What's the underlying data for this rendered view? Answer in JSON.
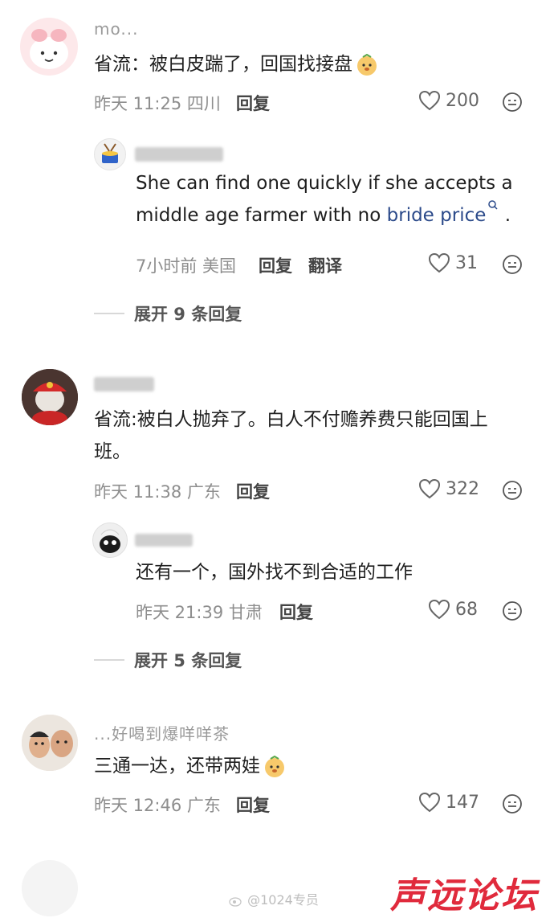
{
  "comments": [
    {
      "username": "mo...",
      "text": "省流：被白皮踹了，回国找接盘",
      "time": "昨天 11:25 四川",
      "reply_label": "回复",
      "likes": "200",
      "sub_reply": {
        "text_a": "She can find one quickly if she accepts a middle age farmer with no ",
        "link": "bride price",
        "text_b": " .",
        "time": "7小时前 美国",
        "reply_label": "回复",
        "translate_label": "翻译",
        "likes": "31"
      },
      "expand_label": "展开 9 条回复"
    },
    {
      "text": "省流:被白人抛弃了。白人不付赡养费只能回国上班。",
      "time": "昨天 11:38 广东",
      "reply_label": "回复",
      "likes": "322",
      "sub_reply": {
        "text": "还有一个，国外找不到合适的工作",
        "time": "昨天 21:39 甘肃",
        "reply_label": "回复",
        "likes": "68"
      },
      "expand_label": "展开 5 条回复"
    },
    {
      "username": "...好喝到爆咩咩茶",
      "text": "三通一达，还带两娃",
      "time": "昨天 12:46 广东",
      "reply_label": "回复",
      "likes": "147"
    }
  ],
  "watermark": "@1024专员",
  "brand": "声远论坛",
  "colors": {
    "brand": "#e02a3c",
    "link": "#2b4a8a"
  }
}
